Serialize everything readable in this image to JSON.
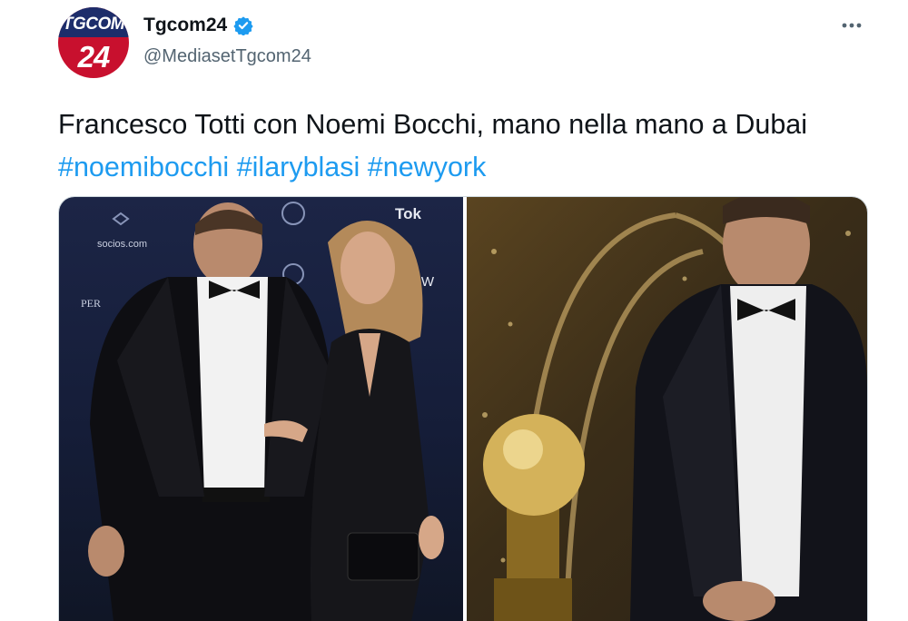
{
  "account": {
    "avatar_brand": "TGCOM",
    "avatar_number": "24",
    "display_name": "Tgcom24",
    "handle": "@MediasetTgcom24"
  },
  "tweet": {
    "text": "Francesco Totti con Noemi Bocchi, mano nella mano a Dubai",
    "hashtags": [
      "#noemibocchi",
      "#ilaryblasi",
      "#newyork"
    ]
  },
  "media": {
    "left_photo": {
      "backdrop_logos": [
        "socios.com",
        "Tok",
        "CoinW",
        "PER"
      ]
    }
  },
  "icons": {
    "verified": "verified-badge-icon",
    "more": "more-options-icon"
  },
  "colors": {
    "accent": "#1d9bf0",
    "text": "#0f1419",
    "secondary_text": "#536471",
    "border": "#cfd9de"
  }
}
